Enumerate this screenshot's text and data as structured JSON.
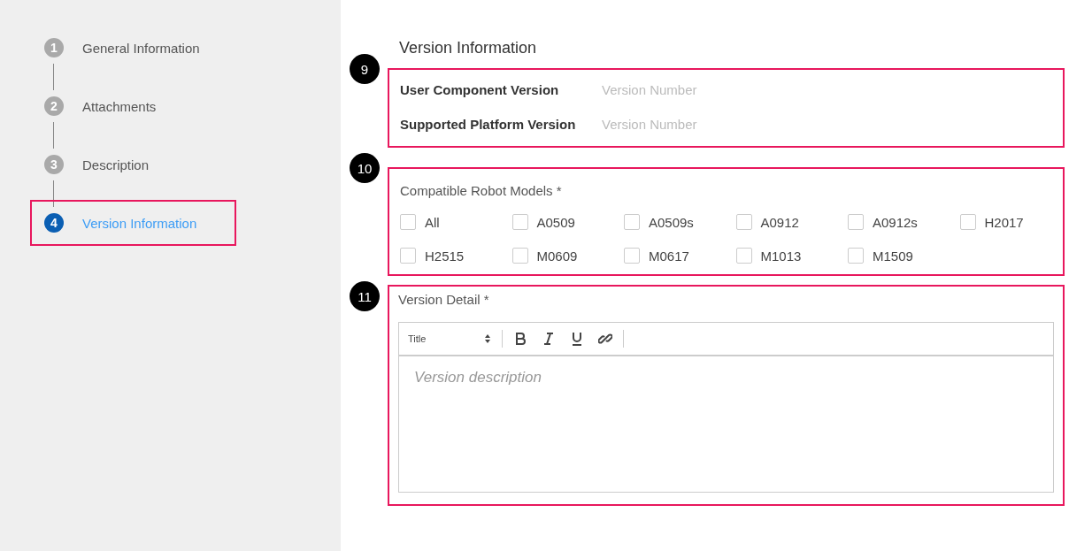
{
  "steps": [
    {
      "number": "1",
      "label": "General Information",
      "selected": false,
      "highlighted": false
    },
    {
      "number": "2",
      "label": "Attachments",
      "selected": false,
      "highlighted": false
    },
    {
      "number": "3",
      "label": "Description",
      "selected": false,
      "highlighted": false
    },
    {
      "number": "4",
      "label": "Version Information",
      "selected": true,
      "highlighted": true
    }
  ],
  "heading": "Version Information",
  "sections": [
    {
      "kind": "fields",
      "marker": "9",
      "fields": [
        {
          "label": "User Component Version",
          "placeholder": "Version Number"
        },
        {
          "label": "Supported Platform Version",
          "placeholder": "Version Number"
        }
      ]
    },
    {
      "kind": "checkboxes",
      "marker": "10",
      "label": "Compatible Robot Models *",
      "options": [
        {
          "label": "All",
          "checked": false
        },
        {
          "label": "A0509",
          "checked": false
        },
        {
          "label": "A0509s",
          "checked": false
        },
        {
          "label": "A0912",
          "checked": false
        },
        {
          "label": "A0912s",
          "checked": false
        },
        {
          "label": "H2017",
          "checked": false
        },
        {
          "label": "H2515",
          "checked": false
        },
        {
          "label": "M0609",
          "checked": false
        },
        {
          "label": "M0617",
          "checked": false
        },
        {
          "label": "M1013",
          "checked": false
        },
        {
          "label": "M1509",
          "checked": false
        }
      ]
    },
    {
      "kind": "editor",
      "marker": "11",
      "label": "Version Detail *",
      "format": "Title",
      "placeholder": "Version description"
    }
  ]
}
